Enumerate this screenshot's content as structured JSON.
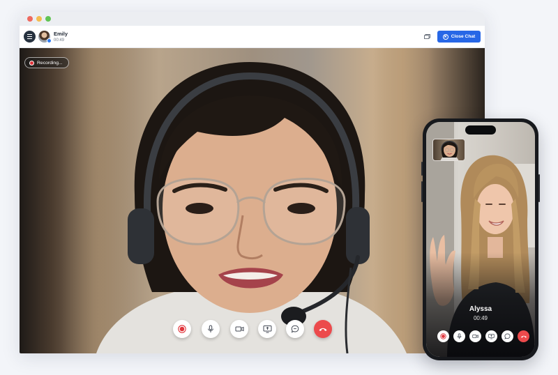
{
  "window": {
    "caller_name": "Emily",
    "call_duration": "00:49",
    "close_chat_label": "Close Chat",
    "recording_label": "Recording..."
  },
  "controls": [
    "record-icon",
    "microphone-icon",
    "camera-icon",
    "screen-share-icon",
    "chat-icon",
    "end-call-icon"
  ],
  "phone": {
    "remote_name": "Alyssa",
    "call_duration": "00:49"
  },
  "colors": {
    "accent": "#2767e6",
    "end_call": "#ec4a4c",
    "record": "#e0343b"
  }
}
